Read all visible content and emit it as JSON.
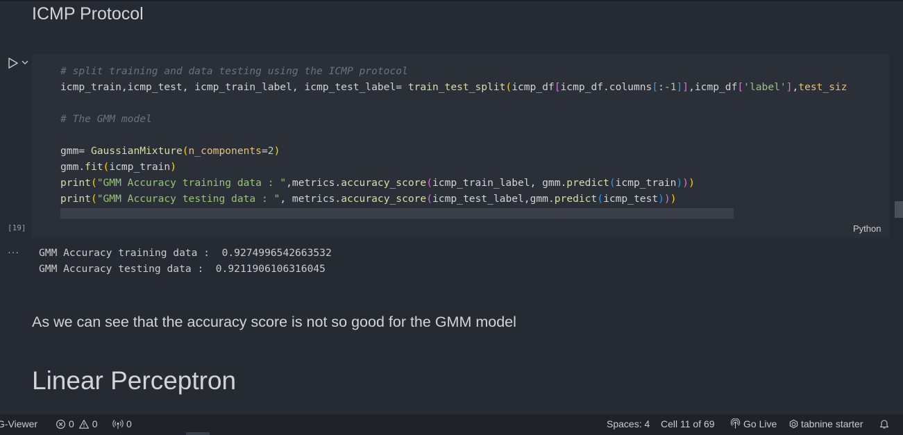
{
  "heading_section": "ICMP Protocol",
  "cell": {
    "exec_count": "[19]",
    "language": "Python",
    "code_lines": [
      "# split training and data testing using the ICMP protocol",
      "icmp_train,icmp_test, icmp_train_label, icmp_test_label= train_test_split(icmp_df[icmp_df.columns[:-1]],icmp_df['label'],test_siz",
      "",
      "# The GMM model",
      "",
      "gmm= GaussianMixture(n_components=2)",
      "gmm.fit(icmp_train)",
      "print(\"GMM Accuracy training data : \",metrics.accuracy_score(icmp_train_label, gmm.predict(icmp_train)))",
      "print(\"GMM Accuracy testing data : \", metrics.accuracy_score(icmp_test_label,gmm.predict(icmp_test)))"
    ]
  },
  "output": {
    "more_label": "···",
    "lines": [
      "GMM Accuracy training data :  0.9274996542663532",
      "GMM Accuracy testing data :  0.9211906106316045"
    ]
  },
  "markdown_text": "As we can see that the accuracy score is not so good for the GMM model",
  "heading_main": "Linear Perceptron",
  "statusbar": {
    "viewer": "G-Viewer",
    "errors": "0",
    "warnings": "0",
    "ports": "0",
    "spaces": "Spaces: 4",
    "cell_pos": "Cell 11 of 69",
    "golive": "Go Live",
    "tabnine": "tabnine starter"
  },
  "icons": [
    "play-icon",
    "chevron-down-icon",
    "error-icon",
    "warning-icon",
    "broadcast-icon",
    "golive-icon",
    "tabnine-icon",
    "bell-icon"
  ],
  "colors": {
    "background": "#262a33",
    "cell_bg": "#2b2f37",
    "statusbar_bg": "#1f2228"
  }
}
